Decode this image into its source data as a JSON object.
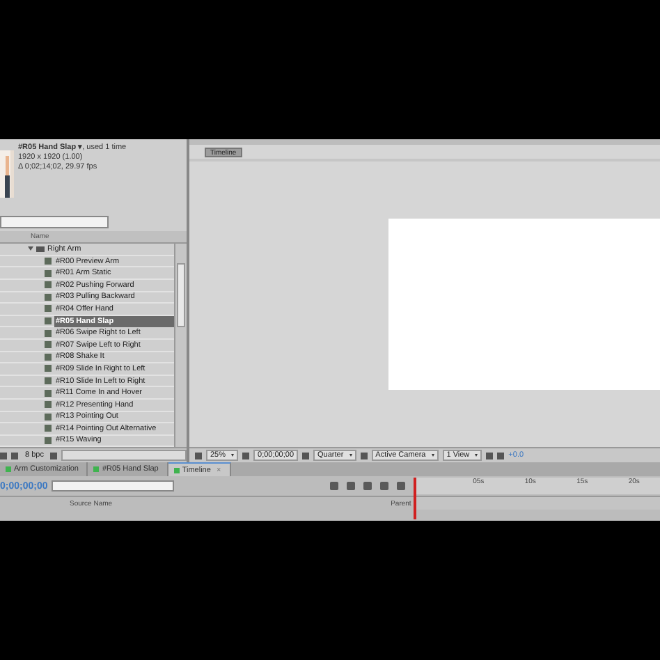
{
  "project_panel": {
    "item_name": "#R05 Hand Slap ▾",
    "usage": ", used 1 time",
    "dimensions": "1920 x 1920 (1.00)",
    "duration": "Δ 0;02;14;02, 29.97 fps",
    "name_column": "Name",
    "tree": [
      {
        "label": "Right Arm",
        "expanded": true,
        "children": [
          {
            "label": "#R00 Preview Arm",
            "selected": false
          },
          {
            "label": "#R01 Arm Static",
            "selected": false
          },
          {
            "label": "#R02 Pushing Forward",
            "selected": false
          },
          {
            "label": "#R03 Pulling Backward",
            "selected": false
          },
          {
            "label": "#R04 Offer Hand",
            "selected": false
          },
          {
            "label": "#R05 Hand Slap",
            "selected": true
          },
          {
            "label": "#R06 Swipe Right to Left",
            "selected": false
          },
          {
            "label": "#R07 Swipe Left to Right",
            "selected": false
          },
          {
            "label": "#R08 Shake It",
            "selected": false
          },
          {
            "label": "#R09 Slide In Right to Left",
            "selected": false
          },
          {
            "label": "#R10 Slide In Left to Right",
            "selected": false
          },
          {
            "label": "#R11 Come In and Hover",
            "selected": false
          },
          {
            "label": "#R12 Presenting Hand",
            "selected": false
          },
          {
            "label": "#R13 Pointing Out",
            "selected": false
          },
          {
            "label": "#R14 Pointing Out Alternative",
            "selected": false
          },
          {
            "label": "#R15 Waving",
            "selected": false
          }
        ]
      }
    ],
    "bit_depth": "8 bpc"
  },
  "composition_panel": {
    "tab_button": "Timeline",
    "zoom": "25%",
    "timecode": "0;00;00;00",
    "resolution": "Quarter",
    "camera": "Active Camera",
    "views": "1 View",
    "exposure": "+0.0"
  },
  "timeline_panel": {
    "tabs": [
      {
        "label": "Arm Customization",
        "selected": false,
        "color": "#3fb34f"
      },
      {
        "label": "#R05 Hand Slap",
        "selected": false,
        "color": "#3fb34f"
      },
      {
        "label": "Timeline",
        "selected": true,
        "color": "#3fb34f",
        "close": "×"
      }
    ],
    "timecode": "0;00;00;00",
    "columns": [
      "Source Name",
      "Parent"
    ],
    "ruler": [
      "05s",
      "10s",
      "15s",
      "20s"
    ]
  }
}
